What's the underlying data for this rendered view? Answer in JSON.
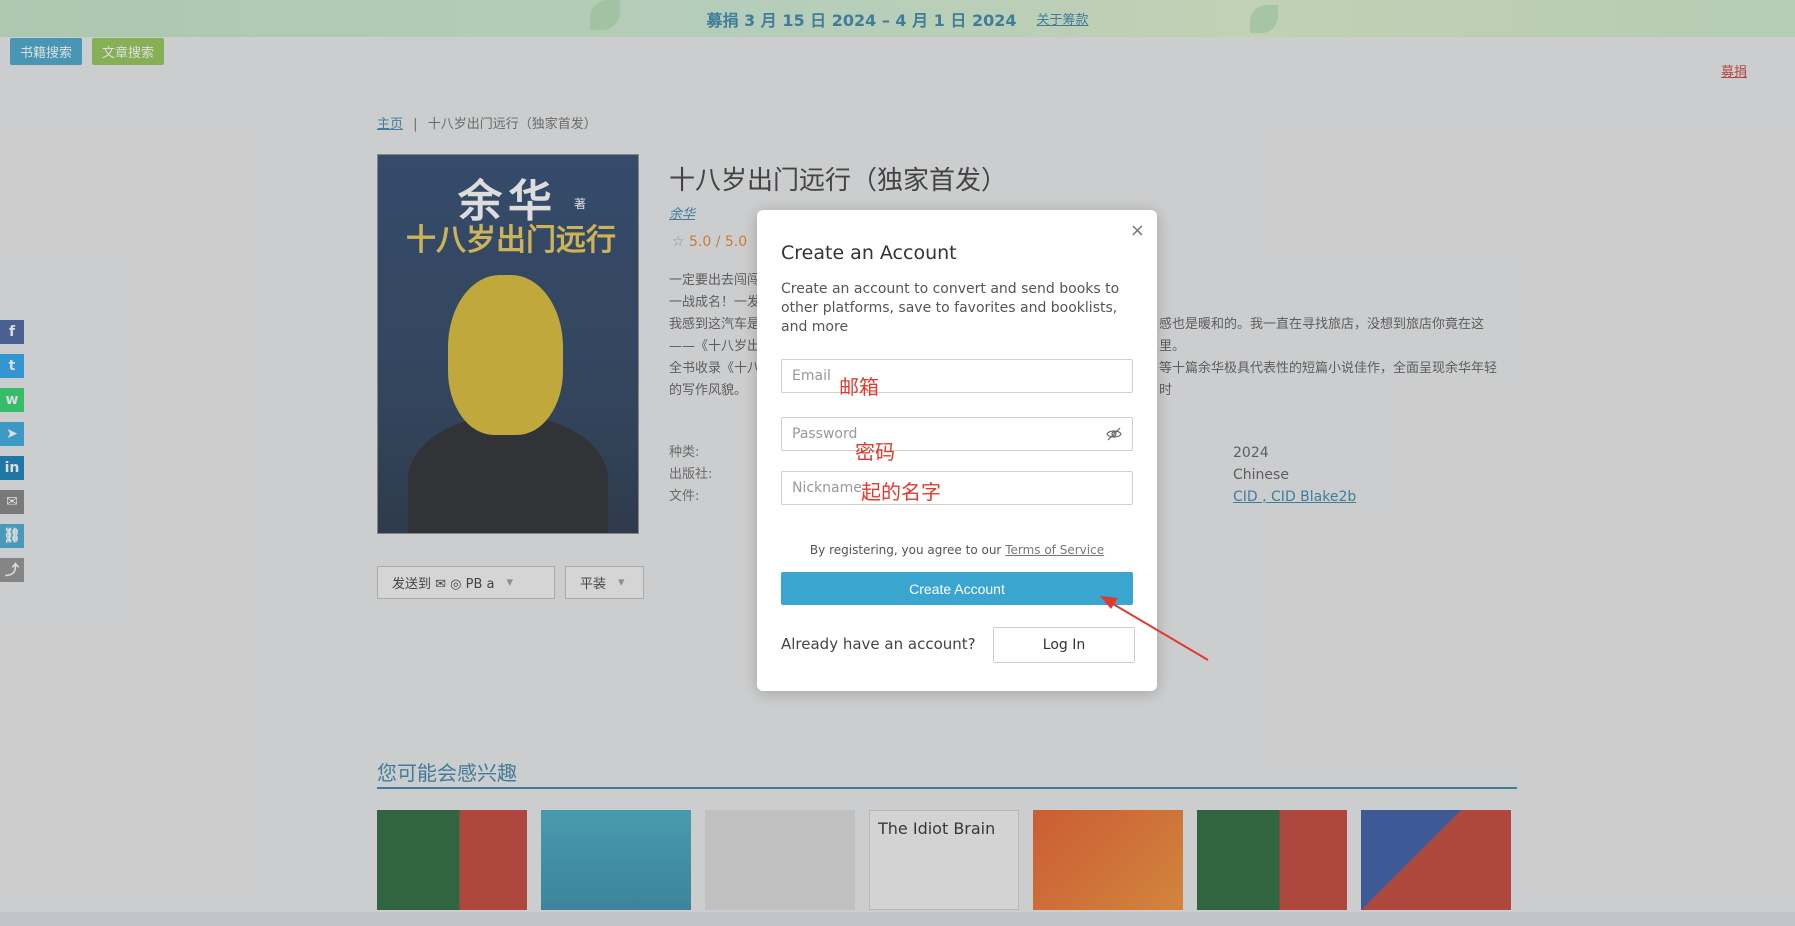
{
  "banner": {
    "text": "募捐 3 月 15 日 2024 – 4 月 1 日 2024",
    "link": "关于筹款"
  },
  "tabs": [
    {
      "label": "书籍搜索"
    },
    {
      "label": "文章搜索"
    }
  ],
  "donate": "募捐",
  "breadcrumb": {
    "home": "主页",
    "sep": "|",
    "current": "十八岁出门远行（独家首发）"
  },
  "cover": {
    "author": "余华",
    "title": "十八岁出门远行",
    "mark": "著"
  },
  "book": {
    "title": "十八岁出门远行（独家首发）",
    "author": "余华",
    "rating": "5.0 / 5.0",
    "desc": [
      "一定要出去闯闯",
      "一战成名！一发",
      "我感到这汽车是",
      "——《十八岁出",
      "全书收录《十八",
      "的写作风貌。"
    ],
    "desc_right": [
      "感也是暖和的。我一直在寻找旅店，没想到旅店你竟在这里。",
      "等十篇余华极具代表性的短篇小说佳作，全面呈现余华年轻时"
    ],
    "meta_labels": [
      "种类:",
      "出版社:",
      "文件:"
    ],
    "meta_values": [
      "2024",
      "Chinese"
    ],
    "meta_links": "CID , CID Blake2b"
  },
  "send_to": "发送到  ✉ ◎ PB a",
  "paperback": "平装",
  "related_title": "您可能会感兴趣",
  "thumb_text": "The Idiot Brain",
  "modal": {
    "title": "Create an Account",
    "subtitle": "Create an account to convert and send books to other platforms, save to favorites and booklists, and more",
    "email_placeholder": "Email",
    "password_placeholder": "Password",
    "nickname_placeholder": "Nickname",
    "anno_email": "邮箱",
    "anno_password": "密码",
    "anno_nickname": "起的名字",
    "terms_prefix": "By registering, you agree to our ",
    "terms_link": "Terms of Service",
    "create_label": "Create Account",
    "already": "Already have an account?",
    "login_label": "Log In",
    "close": "×"
  },
  "colors": {
    "accent": "#3aa6d0",
    "annotation": "#e03a2f"
  }
}
